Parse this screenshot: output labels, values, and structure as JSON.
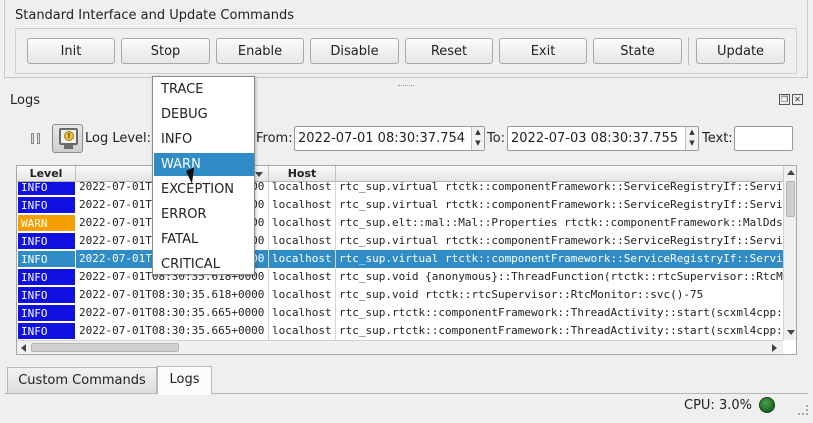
{
  "standard": {
    "title": "Standard Interface and Update Commands",
    "buttons": {
      "init": "Init",
      "stop": "Stop",
      "enable": "Enable",
      "disable": "Disable",
      "reset": "Reset",
      "exit": "Exit",
      "state": "State",
      "update": "Update"
    }
  },
  "logs": {
    "title": "Logs",
    "log_level_label": "Log Level:",
    "from_label": "From:",
    "from_value": "2022-07-01 08:30:37.754",
    "to_label": "To:",
    "to_value": "2022-07-03 08:30:37.755",
    "text_label": "Text:",
    "text_value": "",
    "columns": {
      "level": "Level",
      "host": "Host"
    },
    "rows": [
      {
        "level": "INFO",
        "time": "2022-07-01T08:30:35.452+0000",
        "host": "localhost",
        "message": "rtc_sup.virtual rtctk::componentFramework::ServiceRegistryIf::Servi",
        "level_color": "#1010e0"
      },
      {
        "level": "INFO",
        "time": "2022-07-01T08:30:35.452+0000",
        "host": "localhost",
        "message": "rtc_sup.virtual rtctk::componentFramework::ServiceRegistryIf::Servi",
        "level_color": "#1010e0"
      },
      {
        "level": "WARN",
        "time": "2022-07-01T08:30:35.508+0000",
        "host": "localhost",
        "message": "rtc_sup.elt::mal::Mal::Properties rtctk::componentFramework::MalDds",
        "level_color": "#f6a000"
      },
      {
        "level": "INFO",
        "time": "2022-07-01T08:30:35.562+0000",
        "host": "localhost",
        "message": "rtc_sup.virtual rtctk::componentFramework::ServiceRegistryIf::Servi",
        "level_color": "#1010e0"
      },
      {
        "level": "INFO",
        "time": "2022-07-01T08:30:35.562+0000",
        "host": "localhost",
        "message": "rtc_sup.virtual rtctk::componentFramework::ServiceRegistryIf::Servi",
        "level_color": "#308cc6",
        "selected": true
      },
      {
        "level": "INFO",
        "time": "2022-07-01T08:30:35.618+0000",
        "host": "localhost",
        "message": "rtc_sup.void {anonymous}::ThreadFunction(rtctk::rtcSupervisor::RtcM",
        "level_color": "#1010e0"
      },
      {
        "level": "INFO",
        "time": "2022-07-01T08:30:35.618+0000",
        "host": "localhost",
        "message": "rtc_sup.void rtctk::rtcSupervisor::RtcMonitor::svc()-75",
        "level_color": "#1010e0"
      },
      {
        "level": "INFO",
        "time": "2022-07-01T08:30:35.665+0000",
        "host": "localhost",
        "message": "rtc_sup.rtctk::componentFramework::ThreadActivity::start(scxml4cpp:",
        "level_color": "#1010e0"
      },
      {
        "level": "INFO",
        "time": "2022-07-01T08:30:35.665+0000",
        "host": "localhost",
        "message": "rtc_sup.rtctk::componentFramework::ThreadActivity::start(scxml4cpp:",
        "level_color": "#1010e0"
      }
    ],
    "level_options": [
      "TRACE",
      "DEBUG",
      "INFO",
      "WARN",
      "EXCEPTION",
      "ERROR",
      "FATAL",
      "CRITICAL"
    ],
    "highlighted_option": "WARN"
  },
  "tabs": {
    "custom": "Custom Commands",
    "logs": "Logs"
  },
  "status": {
    "cpu": "CPU: 3.0%"
  }
}
